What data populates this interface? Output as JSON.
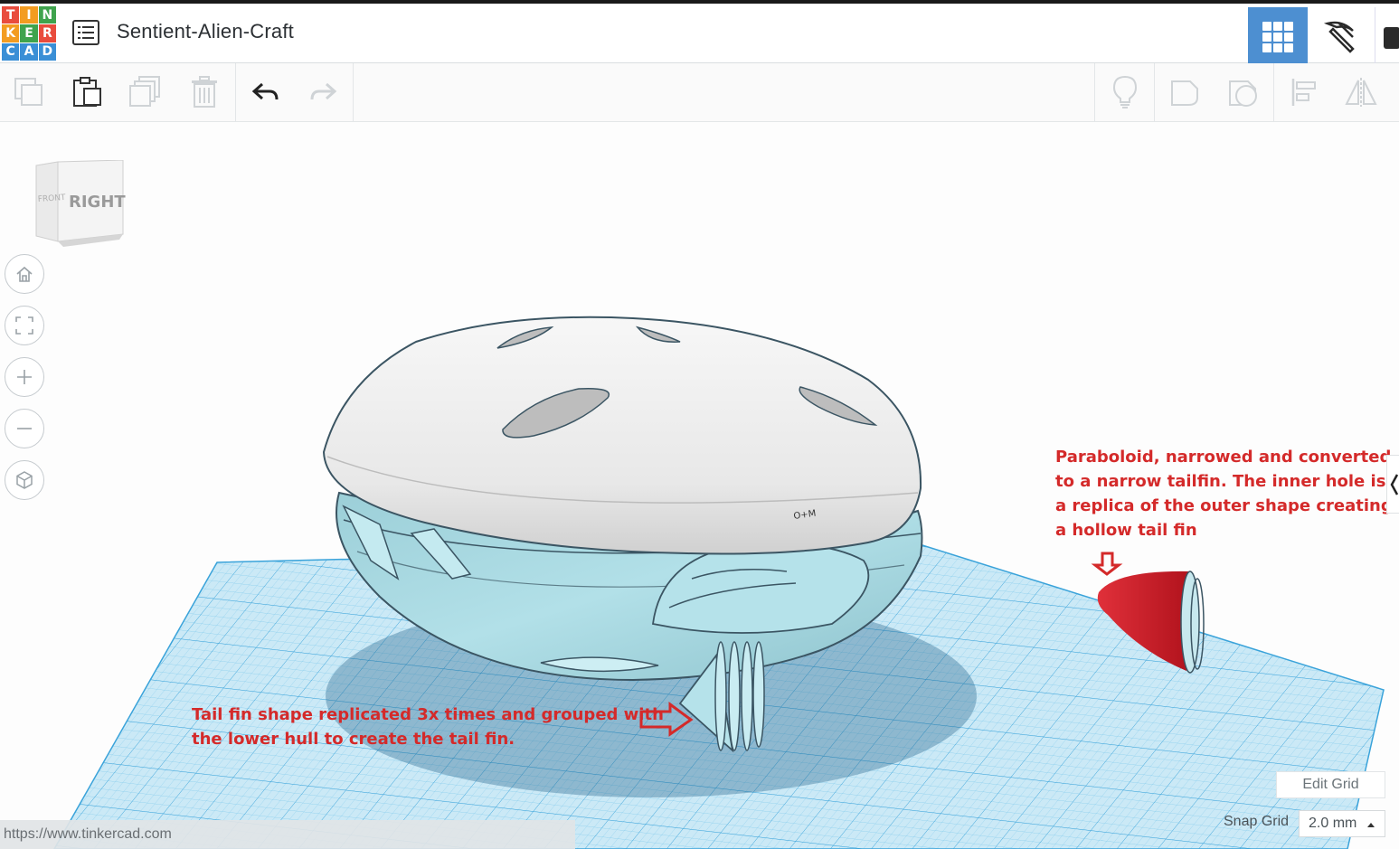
{
  "logo": {
    "letters": [
      "T",
      "I",
      "N",
      "K",
      "E",
      "R",
      "C",
      "A",
      "D"
    ],
    "colors": [
      "#e94c3d",
      "#f39c21",
      "#3fa34d",
      "#f39c21",
      "#3fa34d",
      "#e94c3d",
      "#3a8fd6",
      "#3a8fd6",
      "#3a8fd6"
    ]
  },
  "header": {
    "title": "Sentient-Alien-Craft"
  },
  "toolbar": {
    "icons": [
      "copy-icon",
      "paste-icon",
      "duplicate-icon",
      "delete-icon",
      "undo-icon",
      "redo-icon",
      "lightbulb-icon",
      "note-icon",
      "hole-icon",
      "align-icon",
      "mirror-icon"
    ]
  },
  "viewcube": {
    "face_label": "RIGHT",
    "side_label": "FRONT"
  },
  "navigation": {
    "icons": [
      "home-icon",
      "fit-icon",
      "zoom-in-icon",
      "zoom-out-icon",
      "perspective-icon"
    ]
  },
  "annotations": {
    "right": "Paraboloid, narrowed and converted\nto a narrow tailfin. The inner hole is\na replica of the outer shape creating\na hollow tail fin",
    "left": "Tail fin shape replicated 3x times and grouped with\nthe lower hull to create the tail fin."
  },
  "controls": {
    "edit_grid": "Edit Grid",
    "snap_grid_label": "Snap Grid",
    "snap_grid_value": "2.0 mm"
  },
  "status": {
    "url": "https://www.tinkercad.com"
  },
  "colors": {
    "accent": "#4d8fd1",
    "annotation": "#d42a2a",
    "shape_red": "#d11f2b",
    "hull": "#a9dae3",
    "grid": "#56b6e4"
  }
}
